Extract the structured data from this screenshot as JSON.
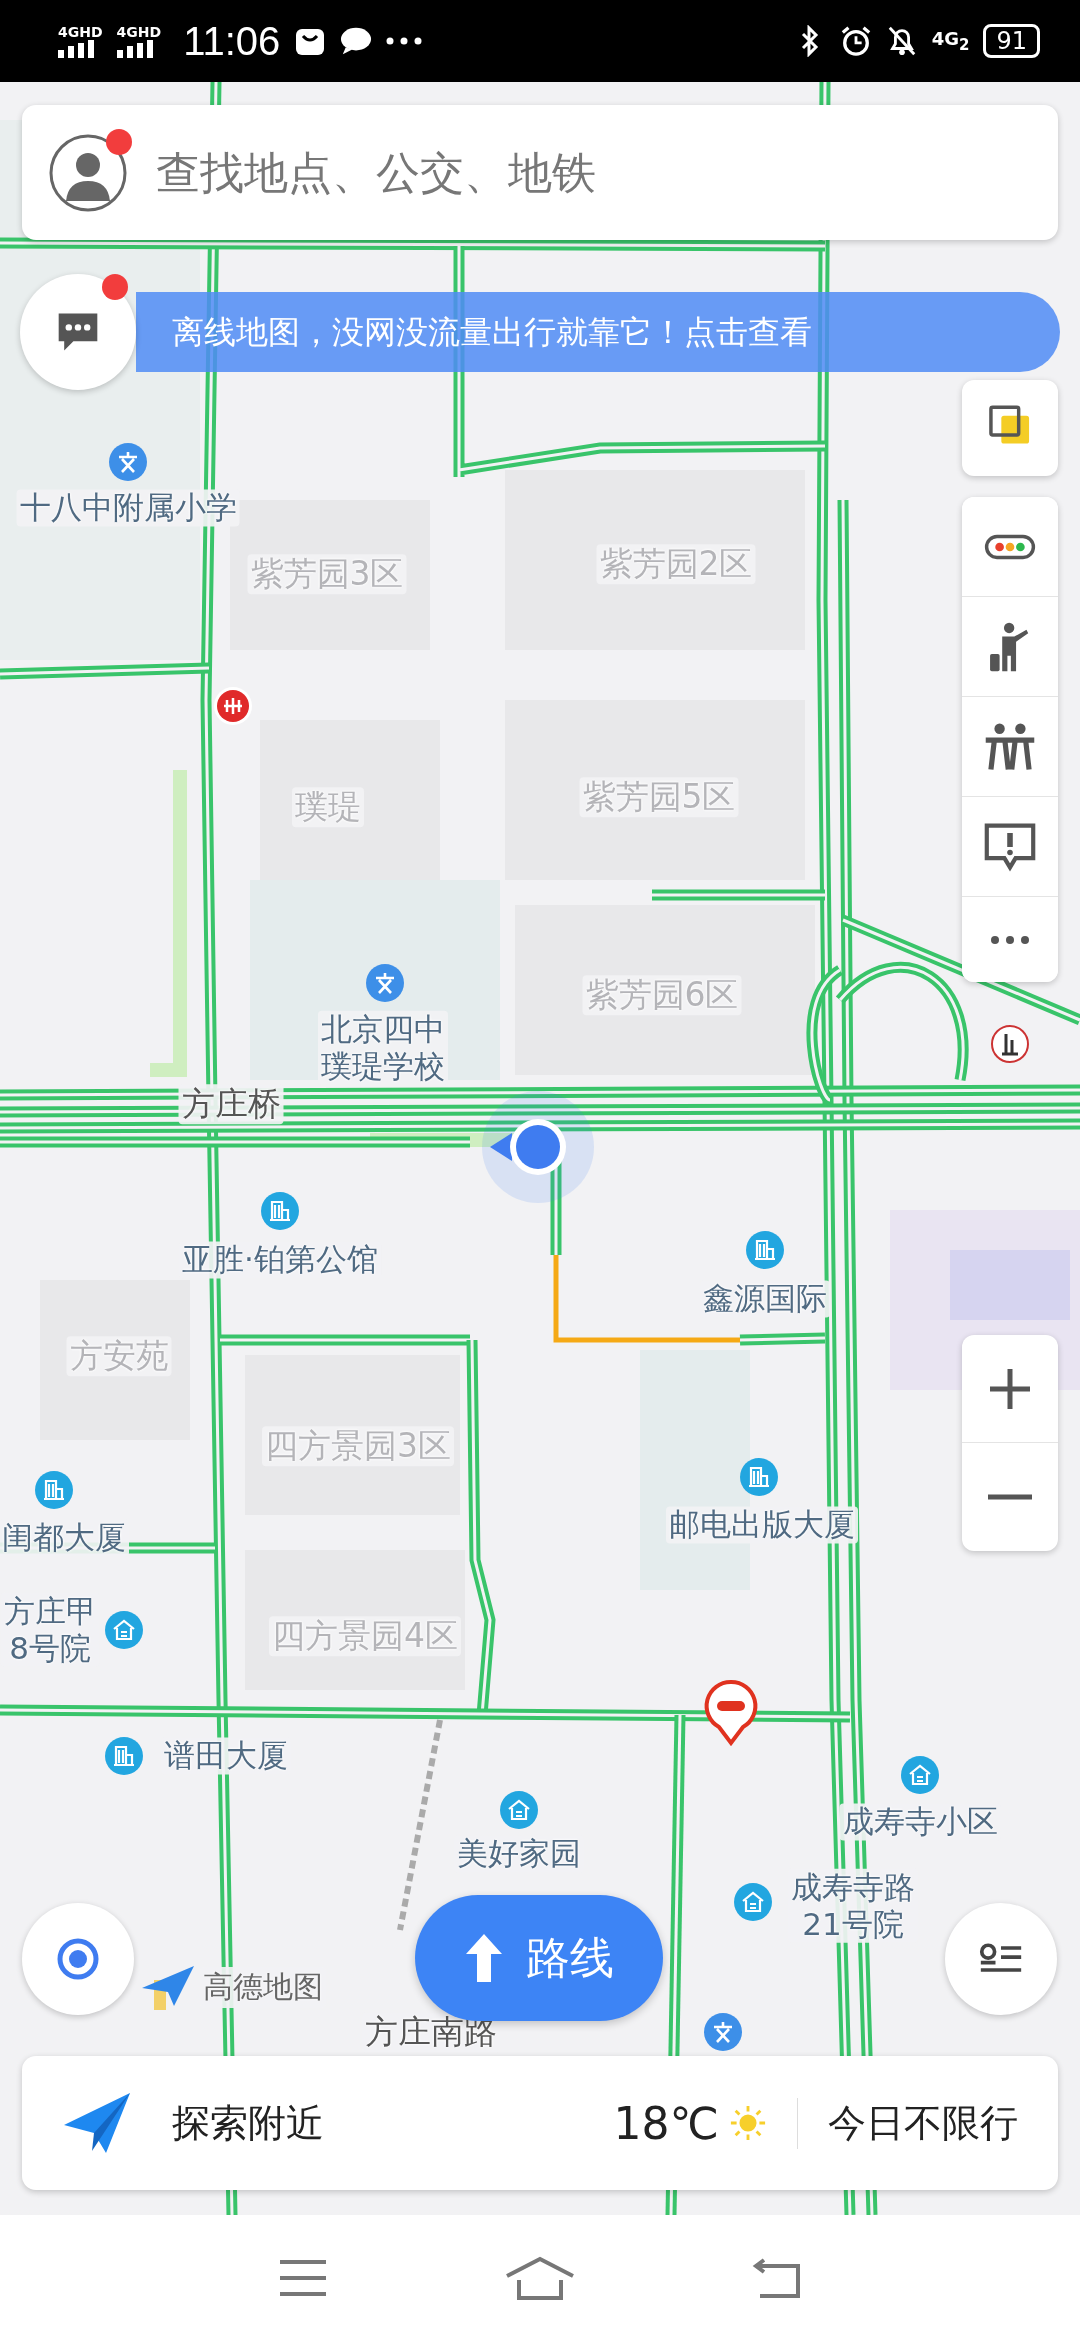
{
  "status_bar": {
    "signal_1": "4GHD",
    "signal_2": "4GHD",
    "time": "11:06",
    "network": "4G$_{2}$",
    "battery": "91"
  },
  "search": {
    "placeholder": "查找地点、公交、地铁",
    "avatar_badge": true
  },
  "banner": {
    "text": "离线地图，没网没流量出行就靠它！点击查看",
    "message_badge": true
  },
  "map_labels": [
    {
      "kind": "poi",
      "lines": [
        "十八中附属小学"
      ]
    },
    {
      "kind": "area",
      "lines": [
        "紫芳园3区"
      ]
    },
    {
      "kind": "area",
      "lines": [
        "紫芳园2区"
      ]
    },
    {
      "kind": "area",
      "lines": [
        "璞瑅"
      ]
    },
    {
      "kind": "area",
      "lines": [
        "紫芳园5区"
      ]
    },
    {
      "kind": "poi",
      "lines": [
        "北京四中",
        "璞瑅学校"
      ]
    },
    {
      "kind": "area",
      "lines": [
        "紫芳园6区"
      ]
    },
    {
      "kind": "road",
      "lines": [
        "方庄桥"
      ]
    },
    {
      "kind": "poi",
      "lines": [
        "亚胜·铂第公馆"
      ]
    },
    {
      "kind": "poi",
      "lines": [
        "鑫源国际"
      ]
    },
    {
      "kind": "area",
      "lines": [
        "方安苑"
      ]
    },
    {
      "kind": "area",
      "lines": [
        "四方景园3区"
      ]
    },
    {
      "kind": "poi",
      "lines": [
        "邮电出版大厦"
      ]
    },
    {
      "kind": "poi",
      "lines": [
        "闺都大厦"
      ]
    },
    {
      "kind": "poi",
      "lines": [
        "方庄甲",
        "8号院"
      ]
    },
    {
      "kind": "area",
      "lines": [
        "四方景园4区"
      ]
    },
    {
      "kind": "poi",
      "lines": [
        "谱田大厦"
      ]
    },
    {
      "kind": "poi",
      "lines": [
        "成寿寺小区"
      ]
    },
    {
      "kind": "poi",
      "lines": [
        "美好家园"
      ]
    },
    {
      "kind": "poi",
      "lines": [
        "成寿寺路",
        "21号院"
      ]
    },
    {
      "kind": "road",
      "lines": [
        "方庄南路"
      ]
    }
  ],
  "logo": {
    "text": "高德地图"
  },
  "route_button": {
    "label": "路线"
  },
  "bottom_bar": {
    "explore": "探索附近",
    "temperature": "18℃",
    "restriction": "今日不限行"
  }
}
